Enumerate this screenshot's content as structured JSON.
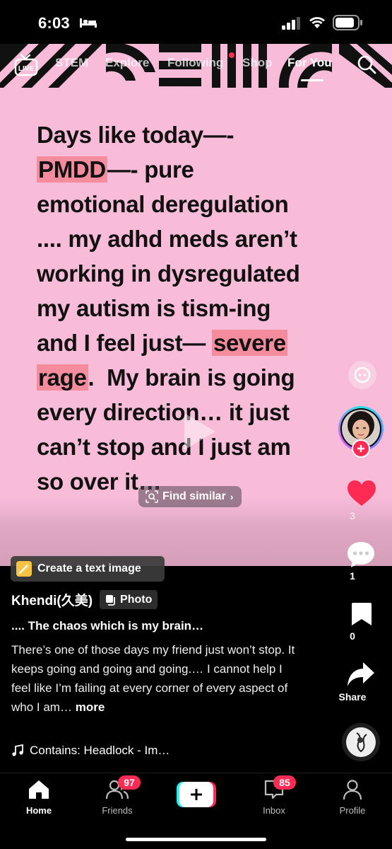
{
  "status_bar": {
    "time": "6:03"
  },
  "top_nav": {
    "items": [
      "STEM",
      "Explore",
      "Following",
      "Shop",
      "For You"
    ],
    "active": "For You"
  },
  "post": {
    "lines": [
      "Days like today—-",
      "PMDD—- pure",
      "emotional deregulation",
      ".... my adhd meds aren’t",
      "working in dysregulated",
      "my autism is tism-ing",
      "and I feel just— severe",
      "rage.  My brain is going",
      "every direction… it just",
      "can’t stop and I just am",
      "so over it…"
    ],
    "highlights": [
      "PMDD",
      "severe",
      "rage"
    ],
    "find_similar": "Find similar",
    "create_text_image": "Create a text image",
    "background_color": "#f8bcd9",
    "highlight_color": "#f58c9e"
  },
  "rail": {
    "likes": "3",
    "comments": "1",
    "saves": "0",
    "share": "Share"
  },
  "caption": {
    "author": "Khendi(久美)",
    "badge": "Photo",
    "title": ".... The chaos which is my brain…",
    "body": "There’s one of those days my friend just won’t stop. It keeps going and going and going.… I cannot help I feel like  I’m failing at every corner of every aspect of who I am…",
    "more": "more",
    "music": "Contains: Headlock - Im…"
  },
  "tabs": {
    "home": "Home",
    "friends": "Friends",
    "friends_badge": "97",
    "inbox": "Inbox",
    "inbox_badge": "85",
    "profile": "Profile"
  },
  "colors": {
    "accent": "#fe2c55"
  }
}
